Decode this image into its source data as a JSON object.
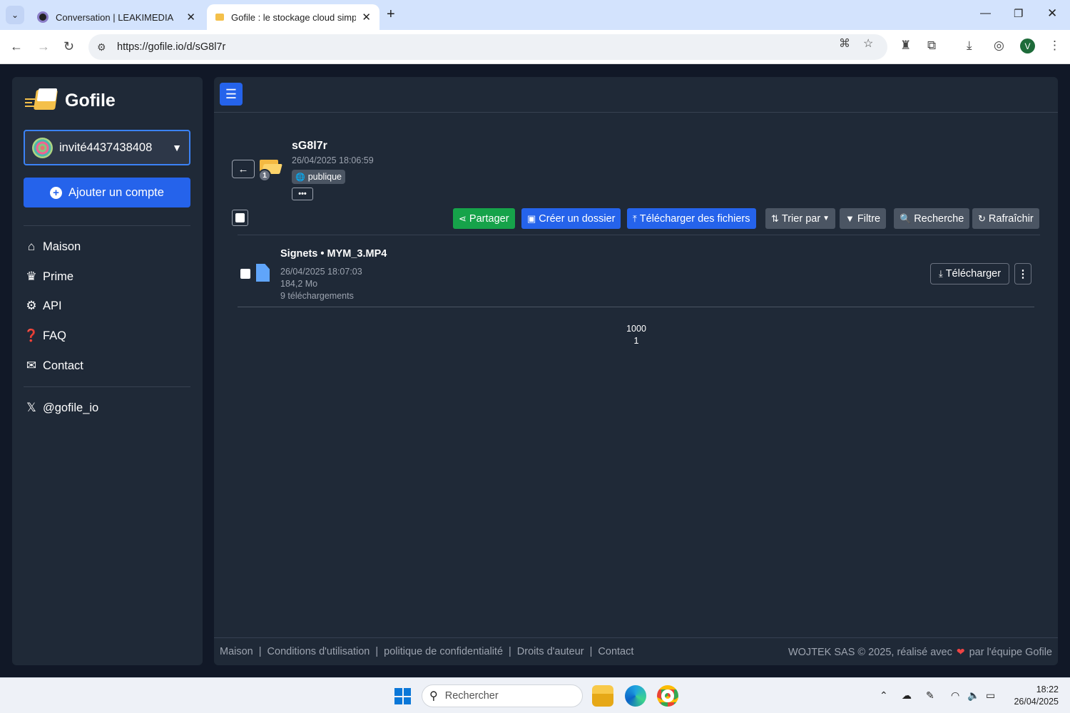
{
  "browser": {
    "tabs": [
      {
        "title": "Conversation | LEAKIMEDIA",
        "active": false
      },
      {
        "title": "Gofile : le stockage cloud simpli",
        "active": true
      }
    ],
    "url": "https://gofile.io/d/sG8l7r",
    "profile_initial": "V"
  },
  "sidebar": {
    "logo_text": "Gofile",
    "account_name": "invité4437438408",
    "add_account_label": "Ajouter un compte",
    "nav": [
      {
        "label": "Maison",
        "icon": "home-icon"
      },
      {
        "label": "Prime",
        "icon": "crown-icon"
      },
      {
        "label": "API",
        "icon": "gears-icon"
      },
      {
        "label": "FAQ",
        "icon": "question-icon"
      },
      {
        "label": "Contact",
        "icon": "envelope-icon"
      }
    ],
    "social": {
      "label": "@gofile_io",
      "icon": "x-logo-icon"
    }
  },
  "folder": {
    "name": "sG8l7r",
    "date": "26/04/2025 18:06:59",
    "visibility": "publique",
    "child_count": "1",
    "more": "•••"
  },
  "toolbar": {
    "share": "Partager",
    "create_folder": "Créer un dossier",
    "upload": "Télécharger des fichiers",
    "sort": "Trier par",
    "filter": "Filtre",
    "search": "Recherche",
    "refresh": "Rafraîchir"
  },
  "files": [
    {
      "name": "Signets • MYM_3.MP4",
      "date": "26/04/2025 18:07:03",
      "size": "184,2 Mo",
      "downloads": "9 téléchargements",
      "download_label": "Télécharger"
    }
  ],
  "pagination": {
    "page_size": "1000",
    "page": "1"
  },
  "footer": {
    "links": [
      "Maison",
      "Conditions d'utilisation",
      "politique de confidentialité",
      "Droits d'auteur",
      "Contact"
    ],
    "separator": "|",
    "credit_left": "WOJTEK SAS © 2025, réalisé avec",
    "credit_right": "par l'équipe Gofile"
  },
  "taskbar": {
    "search_placeholder": "Rechercher",
    "time": "18:22",
    "date": "26/04/2025"
  },
  "colors": {
    "primary": "#2563eb",
    "success": "#16a34a",
    "panel": "#1f2937",
    "background": "#111827"
  }
}
